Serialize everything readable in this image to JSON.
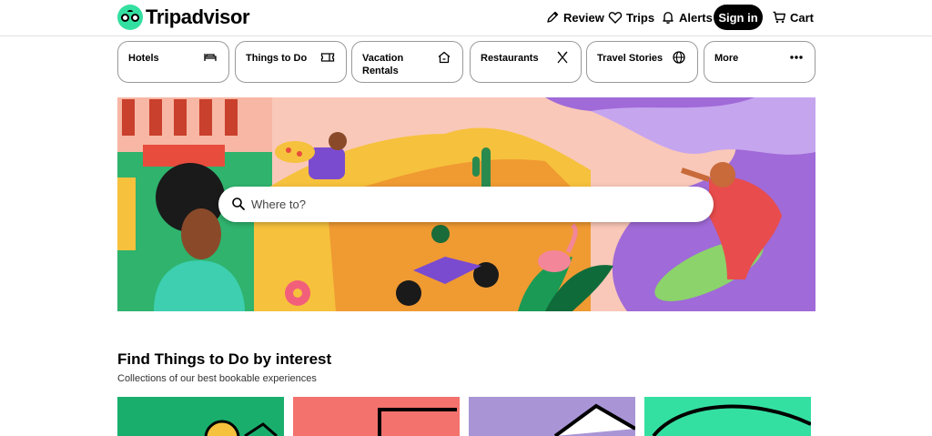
{
  "brand": {
    "name": "Tripadvisor"
  },
  "header": {
    "review_label": "Review",
    "trips_label": "Trips",
    "alerts_label": "Alerts",
    "signin_label": "Sign in",
    "cart_label": "Cart"
  },
  "categories": [
    {
      "label": "Hotels",
      "icon": "bed-icon"
    },
    {
      "label": "Things to Do",
      "icon": "ticket-icon"
    },
    {
      "label": "Vacation Rentals",
      "icon": "house-icon"
    },
    {
      "label": "Restaurants",
      "icon": "utensils-icon"
    },
    {
      "label": "Travel Stories",
      "icon": "globe-icon"
    },
    {
      "label": "More",
      "icon": "more-dots-icon"
    }
  ],
  "search": {
    "placeholder": "Where to?"
  },
  "section": {
    "title": "Find Things to Do by interest",
    "subtitle": "Collections of our best bookable experiences"
  },
  "colors": {
    "accent": "#34e0a1",
    "signin_bg": "#000000"
  }
}
